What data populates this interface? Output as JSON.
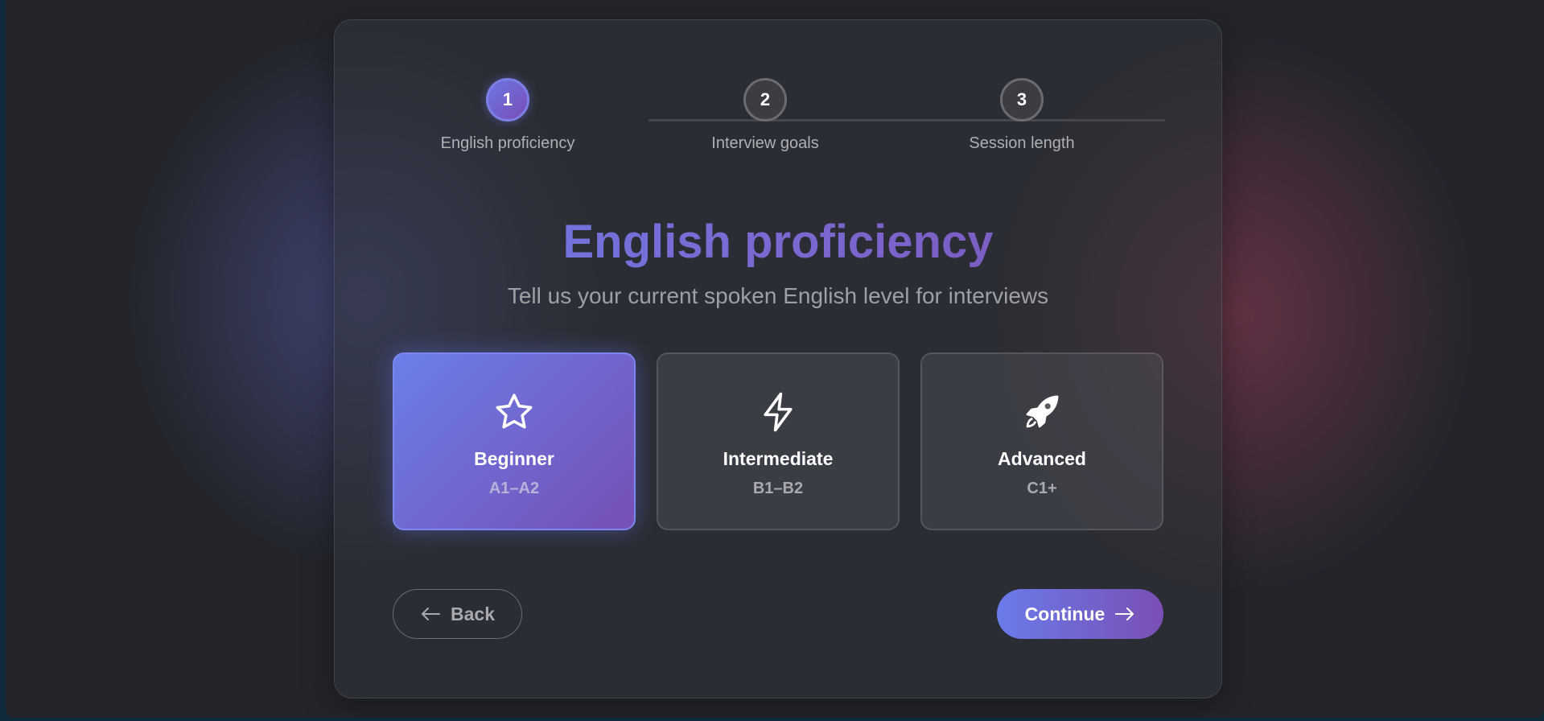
{
  "stepper": {
    "steps": [
      {
        "number": "1",
        "label": "English proficiency",
        "state": "active"
      },
      {
        "number": "2",
        "label": "Interview goals",
        "state": "pending"
      },
      {
        "number": "3",
        "label": "Session length",
        "state": "pending"
      }
    ]
  },
  "header": {
    "title": "English proficiency",
    "subtitle": "Tell us your current spoken English level for interviews"
  },
  "options": [
    {
      "name": "Beginner",
      "code": "A1–A2",
      "icon": "star-icon",
      "selected": true
    },
    {
      "name": "Intermediate",
      "code": "B1–B2",
      "icon": "lightning-icon",
      "selected": false
    },
    {
      "name": "Advanced",
      "code": "C1+",
      "icon": "rocket-icon",
      "selected": false
    }
  ],
  "actions": {
    "back_label": "Back",
    "continue_label": "Continue"
  },
  "colors": {
    "accent_start": "#6b7eea",
    "accent_end": "#7a4fb4",
    "background": "#23252b"
  }
}
